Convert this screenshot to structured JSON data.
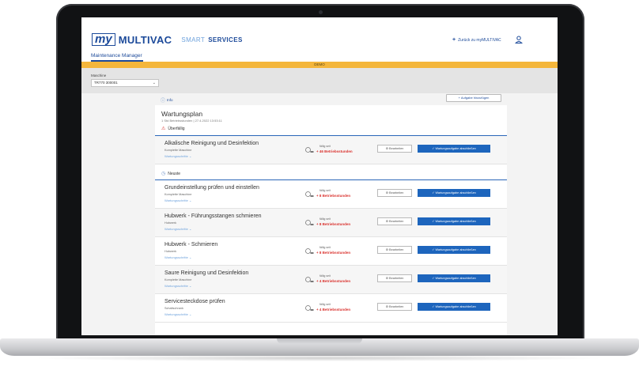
{
  "header": {
    "logo_my": "my",
    "logo_brand": "MULTIVAC",
    "logo_smart": "SMART",
    "logo_services": "SERVICES",
    "back_link": "Zurück zu myMULTIVAC",
    "nav_tab": "Maintenance Manager"
  },
  "demo_banner": "DEMO",
  "machine": {
    "label": "Maschine",
    "selected": "TR770 300001"
  },
  "info_link": "Info",
  "add_task_button": "Aufgabe hinzufügen",
  "plan": {
    "title": "Wartungsplan",
    "subtitle": "1 Std Betriebsstunden | 27.4.2022 13:53:11"
  },
  "groups": {
    "overdue": "Überfällig",
    "upcoming": "Neuste"
  },
  "tasks": [
    {
      "name": "Alkalische Reinigung und Desinfektion",
      "component": "Komplette Maschine",
      "steps": "Wartungsschritte",
      "due_label": "fällig seit",
      "due_value": "+ 46 Betriebsstunden"
    },
    {
      "name": "Grundeinstellung prüfen und einstellen",
      "component": "Komplette Maschine",
      "steps": "Wartungsschritte",
      "due_label": "fällig seit",
      "due_value": "+ 8 Betriebsstunden"
    },
    {
      "name": "Hubwerk - Führungsstangen schmieren",
      "component": "Hubwerk",
      "steps": "Wartungsschritte",
      "due_label": "fällig seit",
      "due_value": "+ 8 Betriebsstunden"
    },
    {
      "name": "Hubwerk - Schmieren",
      "component": "Hubwerk",
      "steps": "Wartungsschritte",
      "due_label": "fällig seit",
      "due_value": "+ 8 Betriebsstunden"
    },
    {
      "name": "Saure Reinigung und Desinfektion",
      "component": "Komplette Maschine",
      "steps": "Wartungsschritte",
      "due_label": "fällig seit",
      "due_value": "+ 4 Betriebsstunden"
    },
    {
      "name": "Servicesteckdose prüfen",
      "component": "Schaltschrank",
      "steps": "Wartungsschritte",
      "due_label": "fällig seit",
      "due_value": "+ 4 Betriebsstunden"
    }
  ],
  "buttons": {
    "edit": "Bearbeiten",
    "complete": "Wartungsaufgabe abschließen"
  },
  "colors": {
    "brand_blue": "#1c4a9a",
    "primary_button": "#1d65bd",
    "demo_banner": "#f4b63b",
    "overdue_red": "#d9302c"
  }
}
